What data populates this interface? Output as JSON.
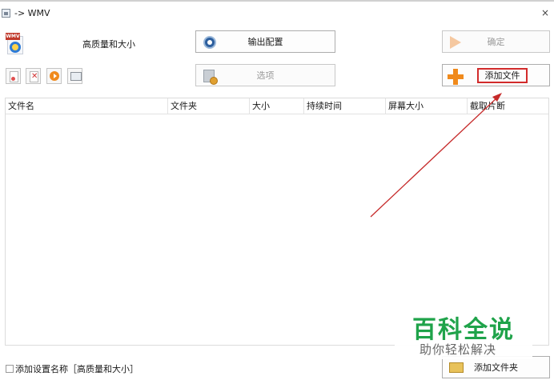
{
  "window": {
    "title": "-> WMV",
    "close_glyph": "×"
  },
  "preset": {
    "label": "高质量和大小",
    "format_badge": "WMV"
  },
  "buttons": {
    "output_config": "输出配置",
    "options": "选项",
    "ok": "确定",
    "add_file": "添加文件",
    "add_folder": "添加文件夹"
  },
  "toolbar": {
    "icons": [
      "new-doc-icon",
      "remove-file-icon",
      "play-icon",
      "screen-icon"
    ]
  },
  "table": {
    "columns": [
      "文件名",
      "文件夹",
      "大小",
      "持续时间",
      "屏幕大小",
      "截取片断"
    ],
    "rows": []
  },
  "footer": {
    "checkbox_checked": false,
    "checkbox_label": "添加设置名称［高质量和大小］"
  },
  "watermark": {
    "title": "百科全说",
    "subtitle": "助你轻松解决"
  },
  "colors": {
    "highlight_box": "#d22b2b",
    "arrow": "#c62a2a",
    "add_icon": "#f08a1c",
    "watermark_green": "#1fa34a"
  }
}
